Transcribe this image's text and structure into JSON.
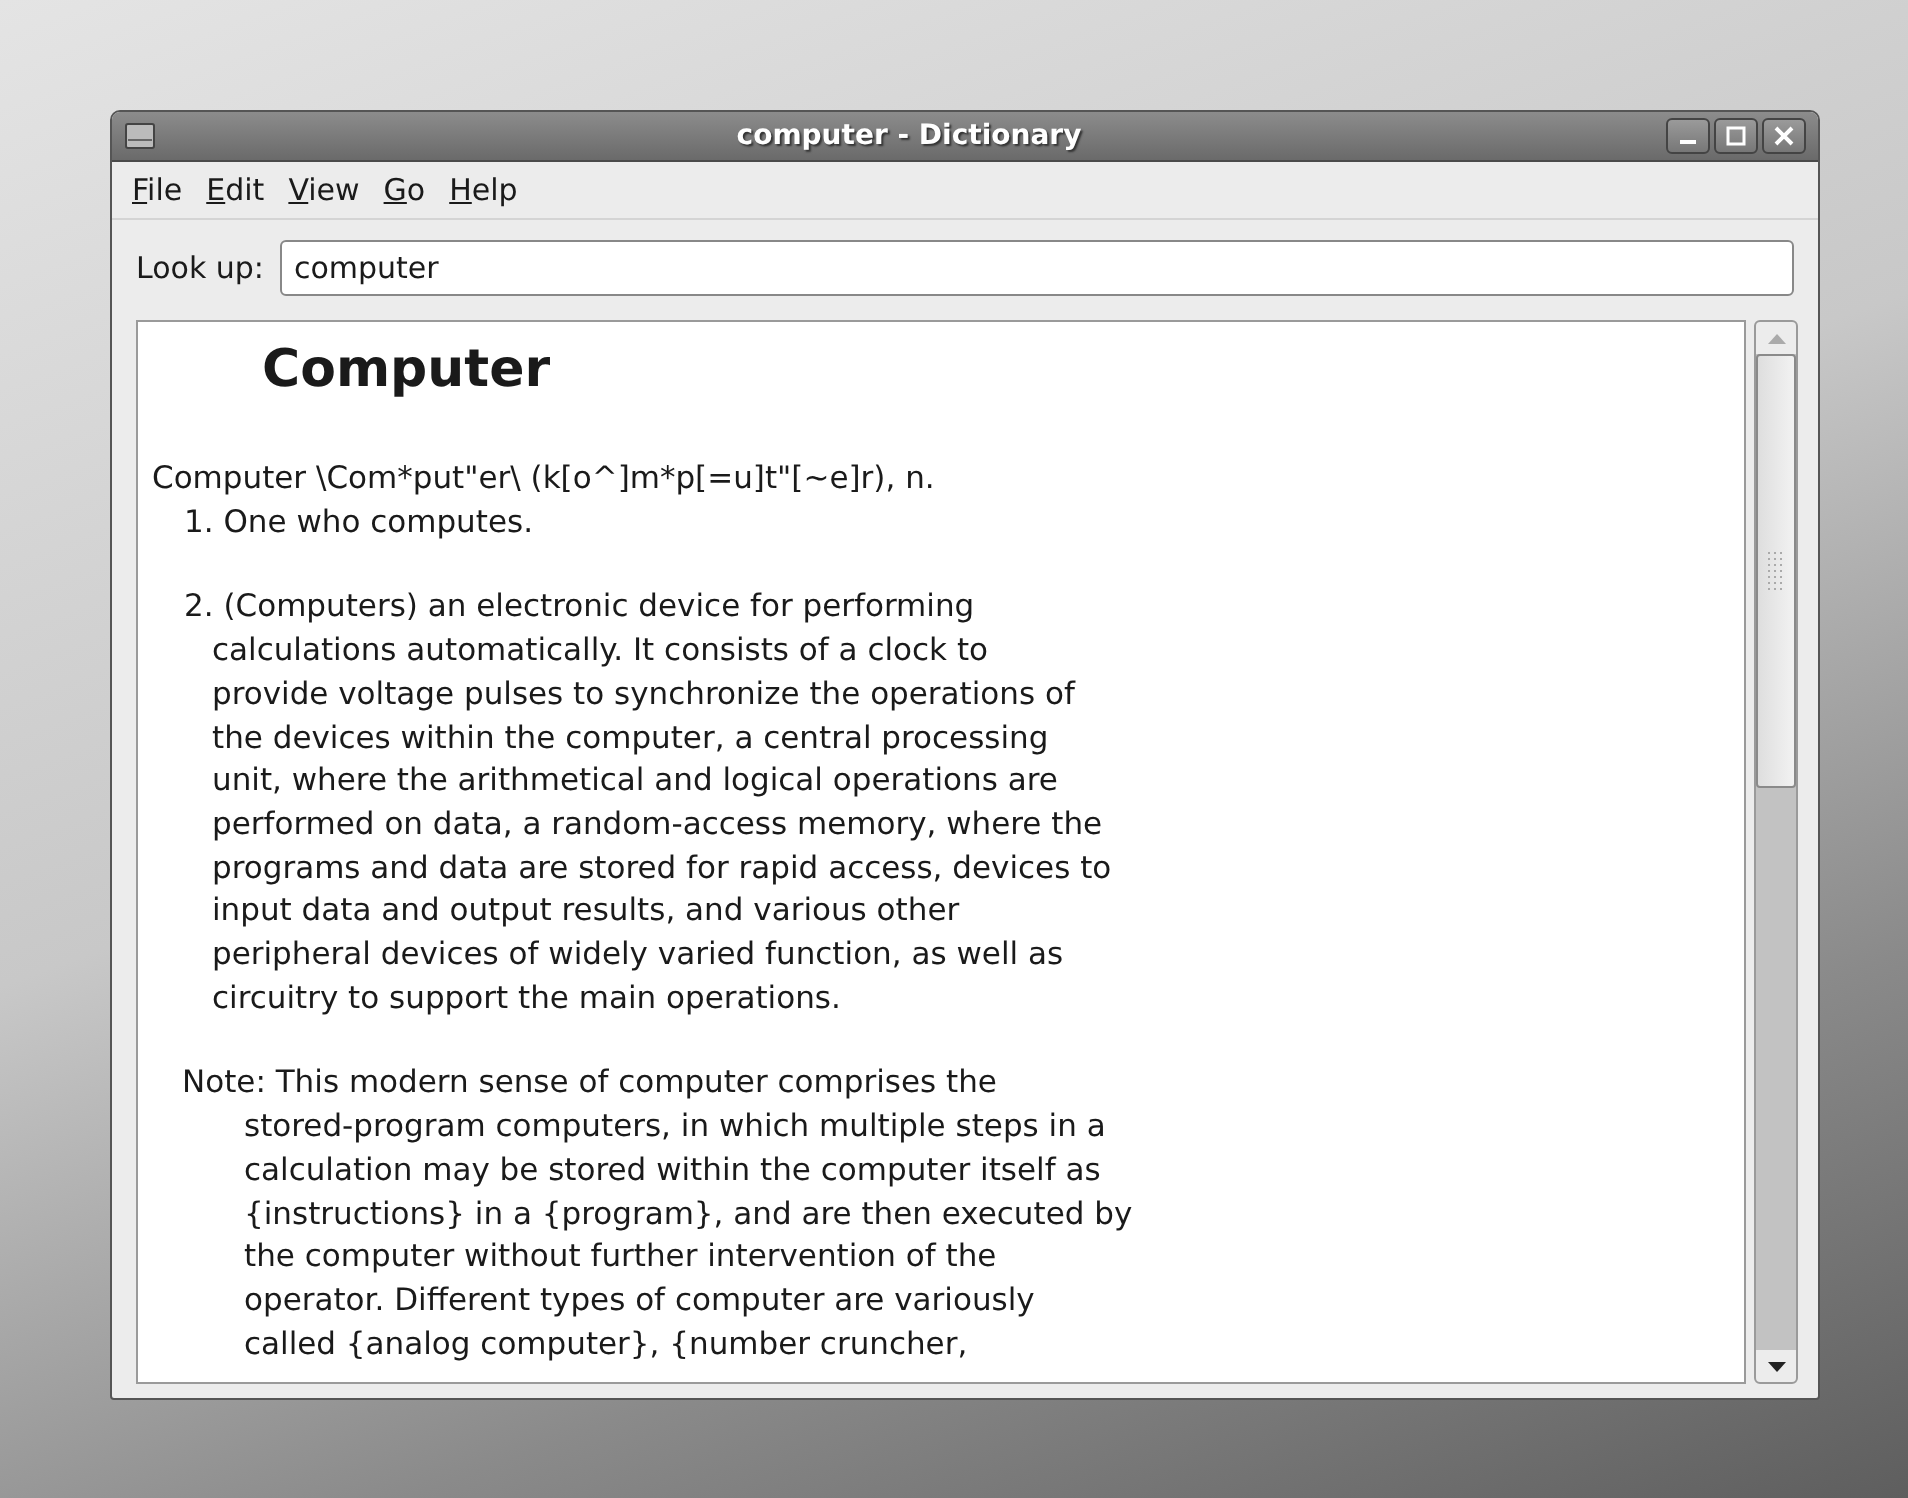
{
  "window": {
    "title": "computer - Dictionary"
  },
  "menu": [
    "File",
    "Edit",
    "View",
    "Go",
    "Help"
  ],
  "lookup": {
    "label": "Look up:",
    "value": "computer"
  },
  "entry": {
    "headword": "Computer",
    "paragraphs": [
      {
        "kind": "pronunciation",
        "lines": [
          "Computer \\Com*put\"er\\ (k[o^]m*p[=u]t\"[~e]r), n."
        ]
      },
      {
        "kind": "sense",
        "lines": [
          "1. One who computes."
        ]
      },
      {
        "kind": "sense",
        "lines": [
          "2. (Computers) an electronic device for performing",
          "calculations automatically. It consists of a clock to",
          "provide voltage pulses to synchronize the operations of",
          "the devices within the computer, a central processing",
          "unit, where the arithmetical and logical operations are",
          "performed on data, a random-access memory, where the",
          "programs and data are stored for rapid access, devices to",
          "input data and output results, and various other",
          "peripheral devices of widely varied function, as well as",
          "circuitry to support the main operations."
        ]
      },
      {
        "kind": "note",
        "lines": [
          "Note: This modern sense of computer comprises the",
          "stored-program computers, in which multiple steps in a",
          "calculation may be stored within the computer itself as",
          "{instructions} in a {program}, and are then executed by",
          "the computer without further intervention of the",
          "operator. Different types of computer are variously",
          "called {analog computer}, {number cruncher,"
        ]
      }
    ]
  }
}
